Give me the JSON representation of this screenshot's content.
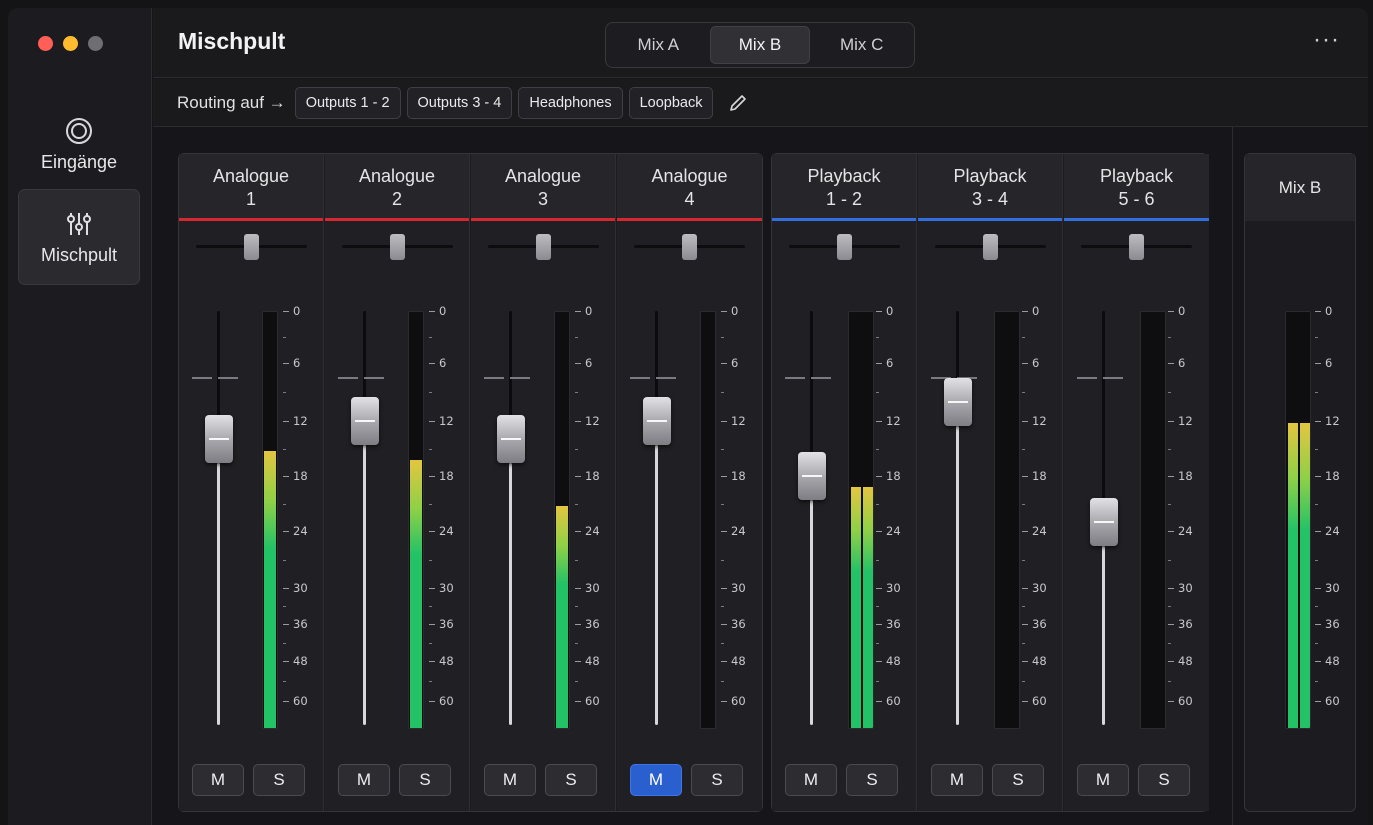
{
  "window": {
    "traffic_lights": [
      "#ff5f57",
      "#febc2e",
      "#6e6e73"
    ]
  },
  "sidebar": {
    "items": [
      {
        "label": "Eingänge",
        "icon": "inputs-icon",
        "active": false
      },
      {
        "label": "Mischpult",
        "icon": "mixer-sliders-icon",
        "active": true
      }
    ]
  },
  "header": {
    "title": "Mischpult",
    "mix_tabs": [
      {
        "label": "Mix A",
        "active": false
      },
      {
        "label": "Mix B",
        "active": true
      },
      {
        "label": "Mix C",
        "active": false
      }
    ],
    "more_label": "···"
  },
  "routing": {
    "label": "Routing auf →",
    "targets": [
      "Outputs 1 - 2",
      "Outputs 3 - 4",
      "Headphones",
      "Loopback"
    ],
    "edit_icon": "pencil-icon"
  },
  "colors": {
    "analogue": "#d6262e",
    "playback": "#2f6fe0",
    "mute_active": "#2a5fd0",
    "meter_green": "#24c266",
    "meter_yellow": "#e3c640"
  },
  "meter_scale": [
    "0",
    "6",
    "12",
    "18",
    "24",
    "30",
    "36",
    "48",
    "60"
  ],
  "channels": [
    {
      "line1": "Analogue",
      "line2": "1",
      "type": "analogue",
      "fader_db": -14,
      "meters": [
        -15
      ],
      "mute_label": "M",
      "solo_label": "S",
      "muted": false
    },
    {
      "line1": "Analogue",
      "line2": "2",
      "type": "analogue",
      "fader_db": -12,
      "meters": [
        -16
      ],
      "mute_label": "M",
      "solo_label": "S",
      "muted": false
    },
    {
      "line1": "Analogue",
      "line2": "3",
      "type": "analogue",
      "fader_db": -14,
      "meters": [
        -21
      ],
      "mute_label": "M",
      "solo_label": "S",
      "muted": false
    },
    {
      "line1": "Analogue",
      "line2": "4",
      "type": "analogue",
      "fader_db": -12,
      "meters": [],
      "mute_label": "M",
      "solo_label": "S",
      "muted": true
    },
    {
      "line1": "Playback",
      "line2": "1 - 2",
      "type": "playback",
      "fader_db": -18,
      "meters": [
        -19,
        -19
      ],
      "mute_label": "M",
      "solo_label": "S",
      "muted": false
    },
    {
      "line1": "Playback",
      "line2": "3 - 4",
      "type": "playback",
      "fader_db": -10,
      "meters": [],
      "mute_label": "M",
      "solo_label": "S",
      "muted": false
    },
    {
      "line1": "Playback",
      "line2": "5 - 6",
      "type": "playback",
      "fader_db": -23,
      "meters": [],
      "mute_label": "M",
      "solo_label": "S",
      "muted": false
    }
  ],
  "master": {
    "label": "Mix B",
    "meters": [
      -12,
      -12
    ]
  }
}
